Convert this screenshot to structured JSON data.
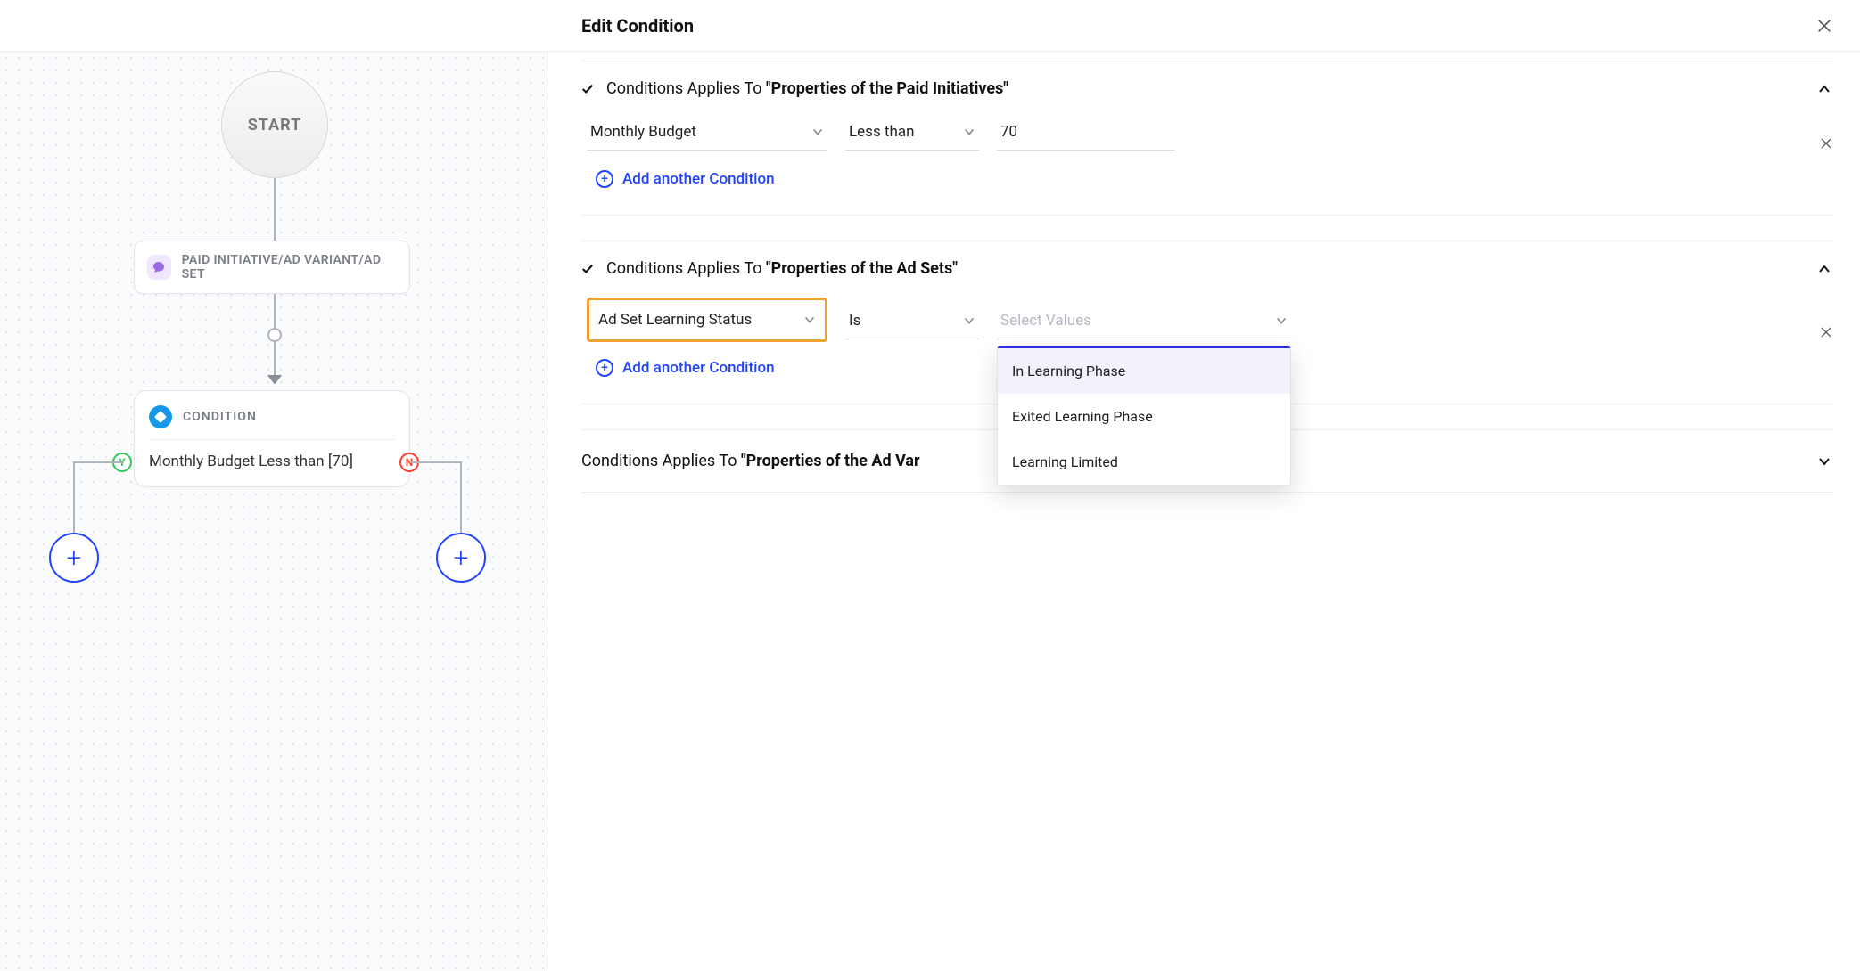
{
  "header": {
    "title": "Edit Condition"
  },
  "canvas": {
    "start_label": "START",
    "pi_label": "PAID INITIATIVE/AD VARIANT/AD SET",
    "condition_title": "CONDITION",
    "condition_text_prefix": "Monthly Budget ",
    "condition_text_suffix": "Less than [70]",
    "yes_badge": "Y",
    "no_badge": "N"
  },
  "panel": {
    "sections": {
      "s1": {
        "checked": true,
        "title_prefix": "Conditions Applies To ",
        "title_quoted": "\"Properties of the Paid Initiatives\"",
        "row": {
          "attribute": "Monthly Budget",
          "operator": "Less than",
          "value": "70"
        },
        "add_label": "Add another Condition"
      },
      "s2": {
        "checked": true,
        "title_prefix": "Conditions Applies To ",
        "title_quoted": "\"Properties of the Ad Sets\"",
        "row": {
          "attribute": "Ad Set Learning Status",
          "operator": "Is",
          "value_placeholder": "Select Values"
        },
        "dropdown_options": [
          "In Learning Phase",
          "Exited Learning Phase",
          "Learning Limited"
        ],
        "add_label": "Add another Condition"
      },
      "s3": {
        "title_prefix": "Conditions Applies To ",
        "title_quoted": "\"Properties of the Ad Var"
      }
    }
  }
}
